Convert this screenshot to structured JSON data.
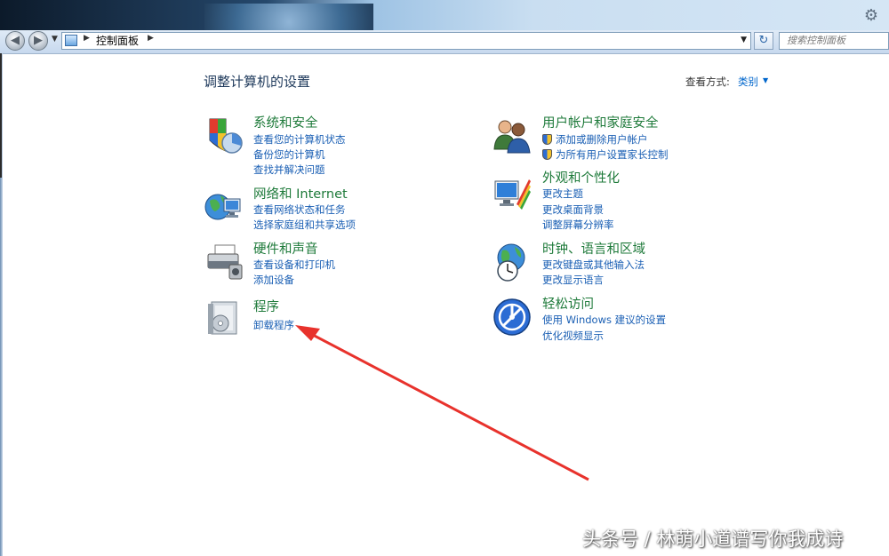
{
  "breadcrumb": {
    "root": "控制面板"
  },
  "search": {
    "placeholder": "搜索控制面板"
  },
  "page": {
    "title": "调整计算机的设置",
    "view_by_label": "查看方式:",
    "view_by_value": "类别"
  },
  "categories": {
    "system_security": {
      "title": "系统和安全",
      "links": [
        "查看您的计算机状态",
        "备份您的计算机",
        "查找并解决问题"
      ]
    },
    "network": {
      "title": "网络和 Internet",
      "links": [
        "查看网络状态和任务",
        "选择家庭组和共享选项"
      ]
    },
    "hardware": {
      "title": "硬件和声音",
      "links": [
        "查看设备和打印机",
        "添加设备"
      ]
    },
    "programs": {
      "title": "程序",
      "links": [
        "卸载程序"
      ]
    },
    "user_accounts": {
      "title": "用户帐户和家庭安全",
      "links": [
        "添加或删除用户帐户",
        "为所有用户设置家长控制"
      ]
    },
    "appearance": {
      "title": "外观和个性化",
      "links": [
        "更改主题",
        "更改桌面背景",
        "调整屏幕分辨率"
      ]
    },
    "clock_region": {
      "title": "时钟、语言和区域",
      "links": [
        "更改键盘或其他输入法",
        "更改显示语言"
      ]
    },
    "ease_access": {
      "title": "轻松访问",
      "links": [
        "使用 Windows 建议的设置",
        "优化视频显示"
      ]
    }
  },
  "icons": {
    "nav_back": "back-icon",
    "nav_forward": "forward-icon",
    "refresh": "refresh-icon",
    "settings": "gear-icon"
  },
  "watermark": "头条号 / 林萌小道谱写你我成诗",
  "colors": {
    "category_title": "#1e7a3a",
    "link": "#1a5fb4",
    "page_title": "#1e395b",
    "annotation_arrow": "#e8322c"
  }
}
